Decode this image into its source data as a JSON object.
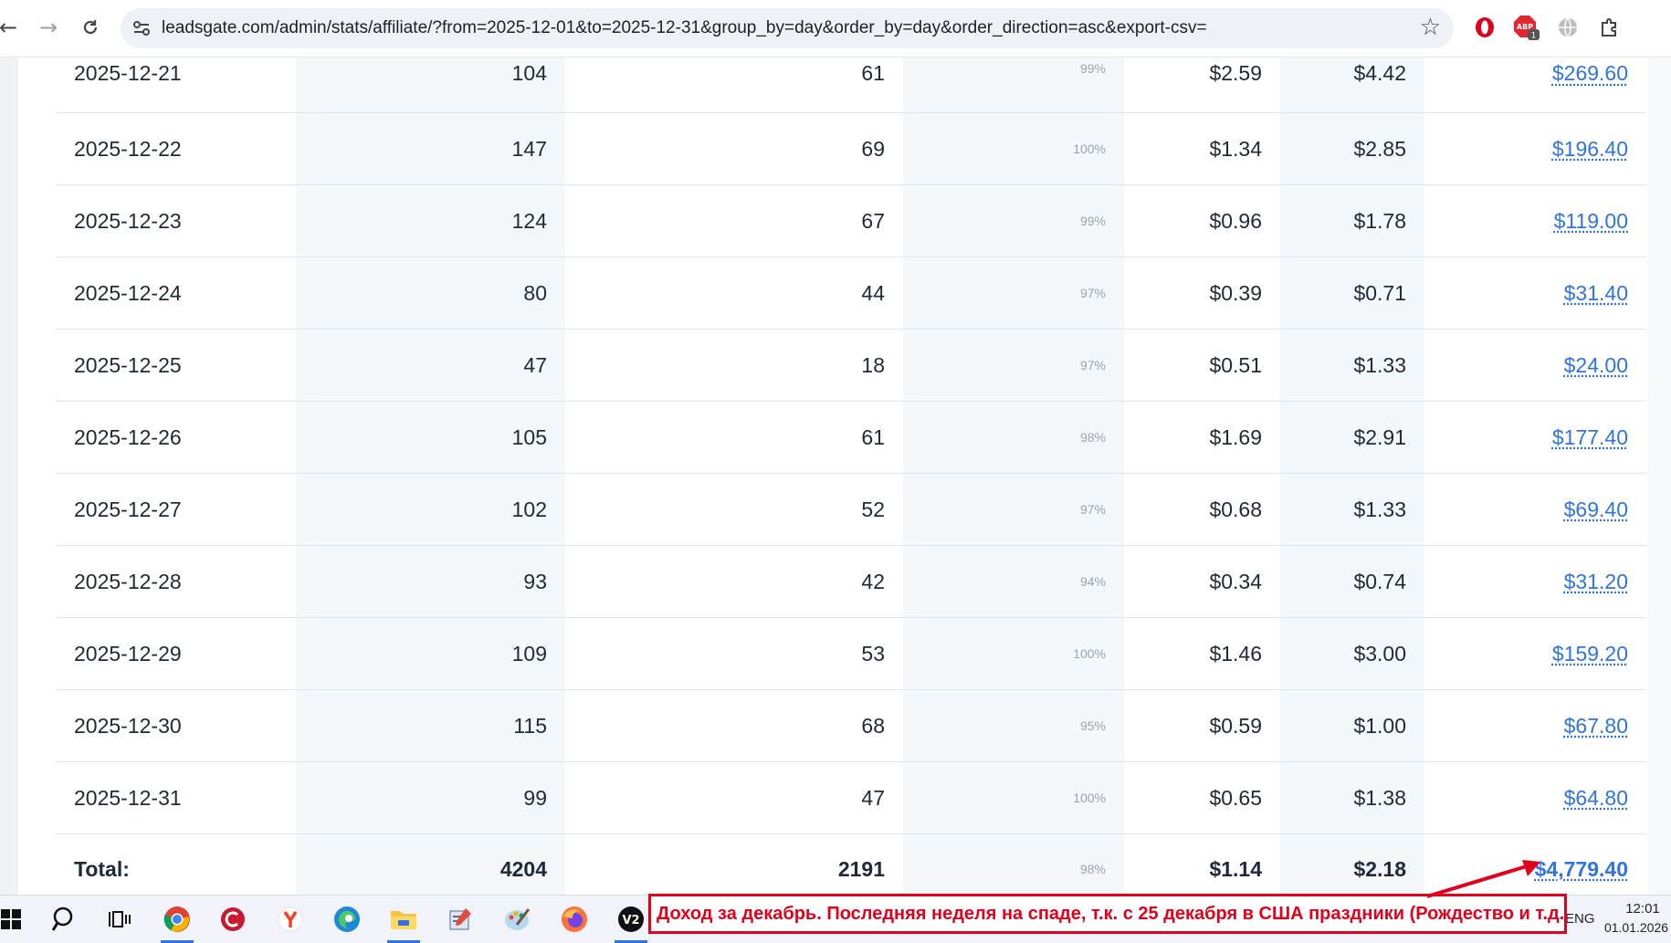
{
  "browser": {
    "url": "leadsgate.com/admin/stats/affiliate/?from=2025-12-01&to=2025-12-31&group_by=day&order_by=day&order_direction=asc&export-csv=",
    "ext_badge": "1",
    "icons": [
      "back-arrow-icon",
      "forward-arrow-icon",
      "reload-icon",
      "site-info-icon",
      "bookmark-star-icon",
      "opera-icon",
      "adblock-icon",
      "globe-icon",
      "extensions-puzzle-icon"
    ]
  },
  "table": {
    "rows": [
      {
        "date": "2025-12-21",
        "c1": "104",
        "c2": "61",
        "pct": "99%",
        "c4": "$2.59",
        "c5": "$4.42",
        "revenue": "$269.60"
      },
      {
        "date": "2025-12-22",
        "c1": "147",
        "c2": "69",
        "pct": "100%",
        "c4": "$1.34",
        "c5": "$2.85",
        "revenue": "$196.40"
      },
      {
        "date": "2025-12-23",
        "c1": "124",
        "c2": "67",
        "pct": "99%",
        "c4": "$0.96",
        "c5": "$1.78",
        "revenue": "$119.00"
      },
      {
        "date": "2025-12-24",
        "c1": "80",
        "c2": "44",
        "pct": "97%",
        "c4": "$0.39",
        "c5": "$0.71",
        "revenue": "$31.40"
      },
      {
        "date": "2025-12-25",
        "c1": "47",
        "c2": "18",
        "pct": "97%",
        "c4": "$0.51",
        "c5": "$1.33",
        "revenue": "$24.00"
      },
      {
        "date": "2025-12-26",
        "c1": "105",
        "c2": "61",
        "pct": "98%",
        "c4": "$1.69",
        "c5": "$2.91",
        "revenue": "$177.40"
      },
      {
        "date": "2025-12-27",
        "c1": "102",
        "c2": "52",
        "pct": "97%",
        "c4": "$0.68",
        "c5": "$1.33",
        "revenue": "$69.40"
      },
      {
        "date": "2025-12-28",
        "c1": "93",
        "c2": "42",
        "pct": "94%",
        "c4": "$0.34",
        "c5": "$0.74",
        "revenue": "$31.20"
      },
      {
        "date": "2025-12-29",
        "c1": "109",
        "c2": "53",
        "pct": "100%",
        "c4": "$1.46",
        "c5": "$3.00",
        "revenue": "$159.20"
      },
      {
        "date": "2025-12-30",
        "c1": "115",
        "c2": "68",
        "pct": "95%",
        "c4": "$0.59",
        "c5": "$1.00",
        "revenue": "$67.80"
      },
      {
        "date": "2025-12-31",
        "c1": "99",
        "c2": "47",
        "pct": "100%",
        "c4": "$0.65",
        "c5": "$1.38",
        "revenue": "$64.80"
      }
    ],
    "total": {
      "label": "Total:",
      "c1": "4204",
      "c2": "2191",
      "pct": "98%",
      "c4": "$1.14",
      "c5": "$2.18",
      "revenue": "$4,779.40"
    }
  },
  "annotation": {
    "text": "Доход за декабрь. Последняя неделя на спаде, т.к. с 25 декабря в США праздники (Рождество и т.д.)",
    "color": "#e3001b"
  },
  "taskbar": {
    "icons": [
      "windows-start-icon",
      "search-icon",
      "task-view-icon",
      "chrome-icon",
      "ccleaner-icon",
      "yandex-browser-icon",
      "edge-icon",
      "file-explorer-icon",
      "editor-app-icon",
      "paint-icon",
      "firefox-icon",
      "v2-app-icon"
    ],
    "v2_label": "V2",
    "lang": "ENG",
    "time": "12:01",
    "date": "01.01.2026"
  }
}
